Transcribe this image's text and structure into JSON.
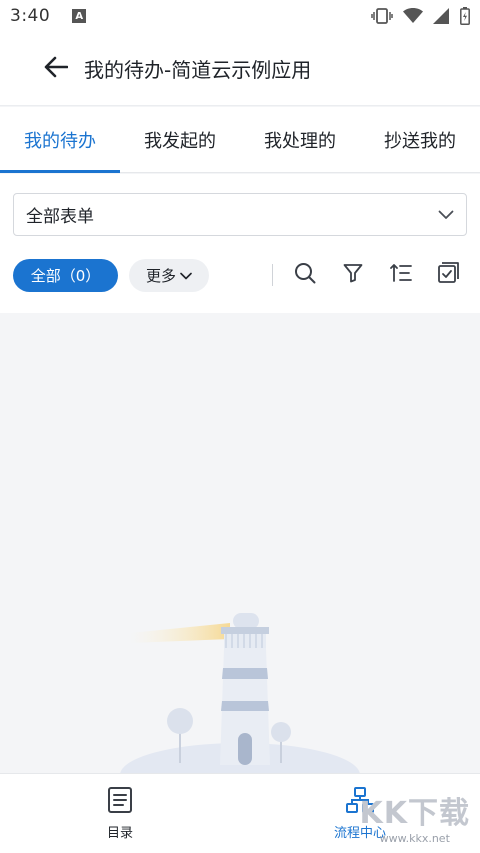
{
  "status_bar": {
    "time": "3:40",
    "notification_letter": "A",
    "icons": [
      "vibrate-icon",
      "wifi-icon",
      "signal-icon",
      "battery-charging-icon"
    ]
  },
  "header": {
    "back_icon": "arrow-left-icon",
    "title": "我的待办-简道云示例应用"
  },
  "tabs": [
    {
      "label": "我的待办",
      "active": true
    },
    {
      "label": "我发起的",
      "active": false
    },
    {
      "label": "我处理的",
      "active": false
    },
    {
      "label": "抄送我的",
      "active": false
    }
  ],
  "form_select": {
    "value": "全部表单",
    "icon": "chevron-down-icon"
  },
  "filters": {
    "all_label": "全部（0）",
    "more_label": "更多",
    "tool_icons": [
      "search-icon",
      "filter-icon",
      "sort-icon",
      "batch-check-icon"
    ]
  },
  "empty_state": {
    "illustration": "lighthouse-illustration"
  },
  "bottom_nav": [
    {
      "label": "目录",
      "icon": "document-list-icon",
      "active": false
    },
    {
      "label": "流程中心",
      "icon": "flow-tree-icon",
      "active": true
    }
  ],
  "watermark": {
    "brand": "KK下载",
    "url": "www.kkx.net"
  },
  "colors": {
    "accent": "#1b74d0",
    "background": "#f4f5f7"
  }
}
